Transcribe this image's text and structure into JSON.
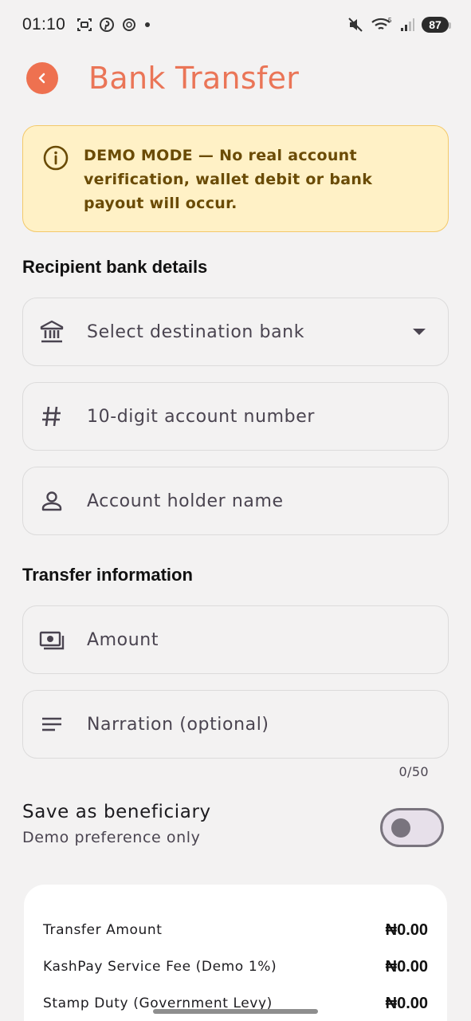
{
  "status_bar": {
    "time": "01:10",
    "battery": "87",
    "signal_badge": "5"
  },
  "header": {
    "title": "Bank Transfer"
  },
  "demo_banner": {
    "text": "DEMO MODE — No real account verification, wallet debit or bank payout will occur."
  },
  "recipient": {
    "heading": "Recipient bank details",
    "bank_placeholder": "Select destination bank",
    "account_placeholder": "10-digit account number",
    "holder_placeholder": "Account holder name"
  },
  "transfer": {
    "heading": "Transfer information",
    "amount_placeholder": "Amount",
    "narration_placeholder": "Narration (optional)",
    "narration_counter": "0/50"
  },
  "beneficiary": {
    "title": "Save as beneficiary",
    "subtitle": "Demo preference only",
    "enabled": false
  },
  "summary": {
    "rows": [
      {
        "label": "Transfer Amount",
        "value": "₦0.00"
      },
      {
        "label": "KashPay Service Fee (Demo 1%)",
        "value": "₦0.00"
      },
      {
        "label": "Stamp Duty (Government Levy)",
        "value": "₦0.00"
      }
    ]
  },
  "colors": {
    "accent": "#ea7557",
    "banner_bg": "#fff1c6",
    "banner_text": "#6a4b05"
  }
}
